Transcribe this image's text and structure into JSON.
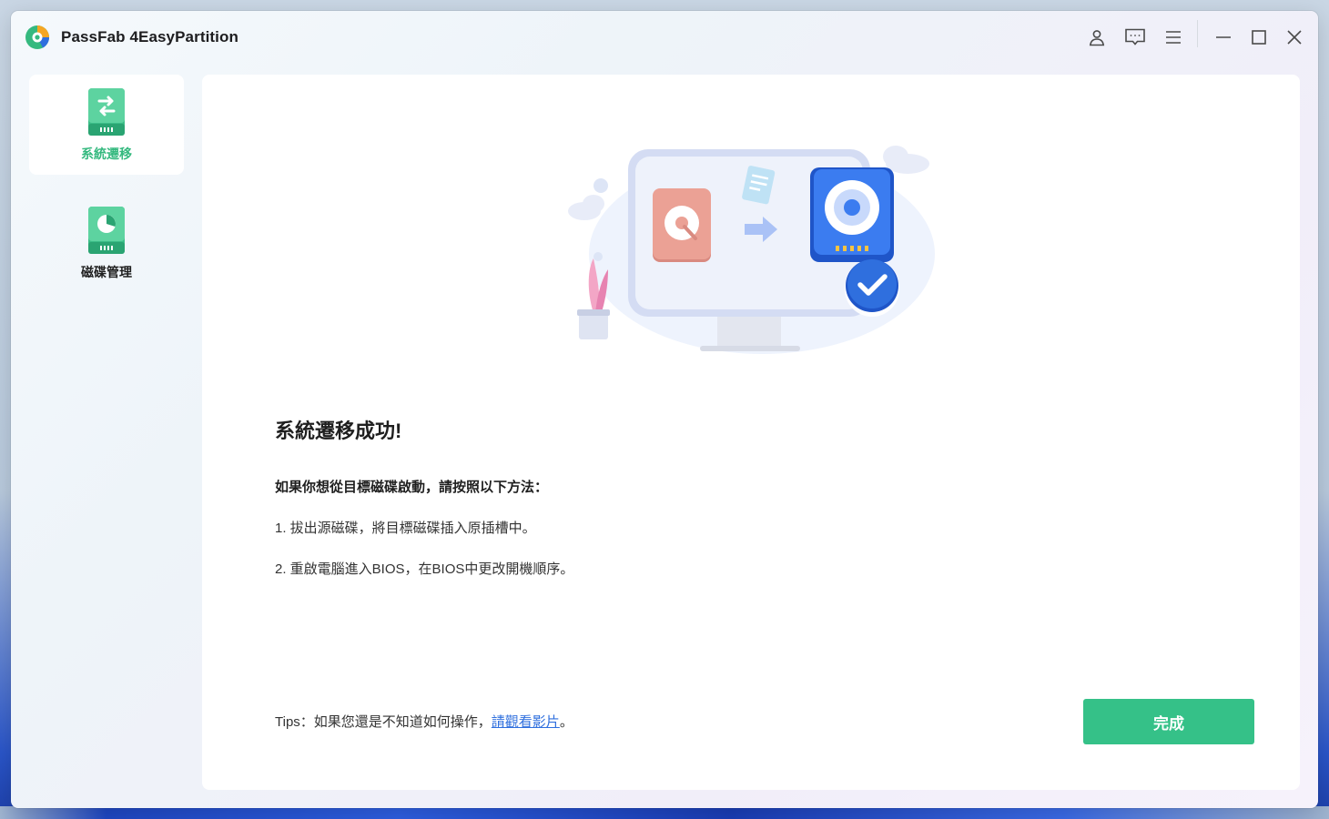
{
  "app": {
    "title": "PassFab 4EasyPartition"
  },
  "titlebar": {
    "icons": [
      "user-icon",
      "feedback-icon",
      "menu-icon",
      "minimize-icon",
      "maximize-icon",
      "close-icon"
    ]
  },
  "sidebar": {
    "items": [
      {
        "label": "系統遷移",
        "icon": "system-migration-icon",
        "active": true
      },
      {
        "label": "磁碟管理",
        "icon": "disk-management-icon",
        "active": false
      }
    ]
  },
  "main": {
    "title": "系統遷移成功!",
    "instruction_heading": "如果你想從目標磁碟啟動，請按照以下方法：",
    "steps": [
      "1. 拔出源磁碟，將目標磁碟插入原插槽中。",
      "2. 重啟電腦進入BIOS，在BIOS中更改開機順序。"
    ],
    "tips_prefix": "Tips：如果您還是不知道如何操作，",
    "tips_link": "請觀看影片",
    "tips_suffix": "。",
    "done_button": "完成"
  },
  "colors": {
    "accent_green": "#35c188",
    "active_nav_text": "#35b97f",
    "link_blue": "#2f6fde",
    "disk_blue": "#2f6fde",
    "disk_red": "#e8968a"
  }
}
